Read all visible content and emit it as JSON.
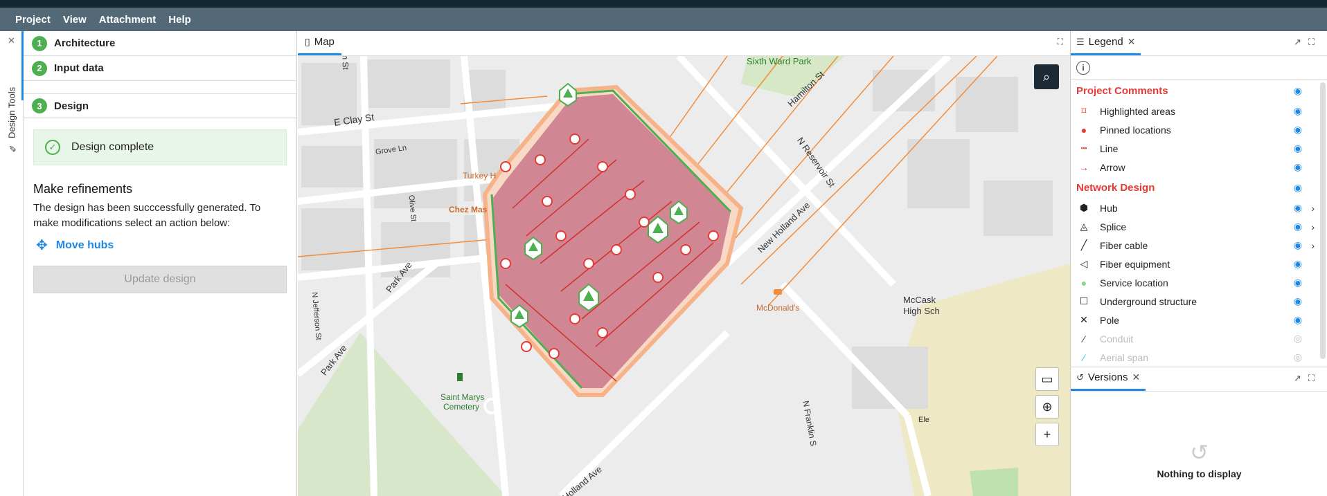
{
  "menu": [
    "Project",
    "View",
    "Attachment",
    "Help"
  ],
  "rail": {
    "label": "Design Tools"
  },
  "steps": [
    {
      "num": "1",
      "label": "Architecture"
    },
    {
      "num": "2",
      "label": "Input data"
    },
    {
      "num": "3",
      "label": "Design"
    }
  ],
  "design": {
    "status": "Design complete",
    "refine_title": "Make refinements",
    "refine_text": "The design has been succcessfully generated. To make modifications select an action below:",
    "move_hubs": "Move hubs",
    "update_button": "Update design"
  },
  "map": {
    "tab": "Map",
    "labels": {
      "sixth_ward": "Sixth Ward Park",
      "hamilton": "Hamilton St",
      "e_clay": "E Clay St",
      "grove": "Grove Ln",
      "turkey": "Turkey H",
      "chez": "Chez Mas",
      "olive": "Olive St",
      "n_reservoir": "N Reservoir St",
      "new_holland": "New Holland Ave",
      "park_ave_1": "Park Ave",
      "park_ave_2": "Park Ave",
      "n_jefferson": "N Jefferson St",
      "mcdonalds": "McDonald's",
      "mccask": "McCask",
      "high_sch": "High Sch",
      "saint_marys": "Saint Marys",
      "cemetery": "Cemetery",
      "n_franklin": "N Franklin S",
      "holland_ave_bottom": "Holland Ave",
      "ele": "Ele",
      "n_s": "n St"
    }
  },
  "legend": {
    "tab": "Legend",
    "groups": [
      {
        "title": "Project Comments",
        "items": [
          {
            "label": "Highlighted areas",
            "icon": "highlight-area-icon",
            "visible": true
          },
          {
            "label": "Pinned locations",
            "icon": "pin-icon",
            "visible": true
          },
          {
            "label": "Line",
            "icon": "line-icon",
            "visible": true
          },
          {
            "label": "Arrow",
            "icon": "arrow-icon",
            "visible": true
          }
        ]
      },
      {
        "title": "Network Design",
        "items": [
          {
            "label": "Hub",
            "icon": "hub-icon",
            "visible": true,
            "expandable": true
          },
          {
            "label": "Splice",
            "icon": "splice-icon",
            "visible": true,
            "expandable": true
          },
          {
            "label": "Fiber cable",
            "icon": "fiber-cable-icon",
            "visible": true,
            "expandable": true
          },
          {
            "label": "Fiber equipment",
            "icon": "fiber-equipment-icon",
            "visible": true
          },
          {
            "label": "Service location",
            "icon": "service-location-icon",
            "visible": true
          },
          {
            "label": "Underground structure",
            "icon": "underground-structure-icon",
            "visible": true
          },
          {
            "label": "Pole",
            "icon": "pole-icon",
            "visible": true
          },
          {
            "label": "Conduit",
            "icon": "conduit-icon",
            "visible": false
          },
          {
            "label": "Aerial span",
            "icon": "aerial-span-icon",
            "visible": false
          }
        ]
      }
    ]
  },
  "versions": {
    "tab": "Versions",
    "empty": "Nothing to display"
  },
  "colors": {
    "accent": "#1e88e5",
    "menubar": "#536977",
    "success": "#4caf50",
    "legend_heading": "#e53935",
    "network_fill": "#c9778a",
    "hub": "#e53935",
    "fiber": "#4caf50"
  }
}
